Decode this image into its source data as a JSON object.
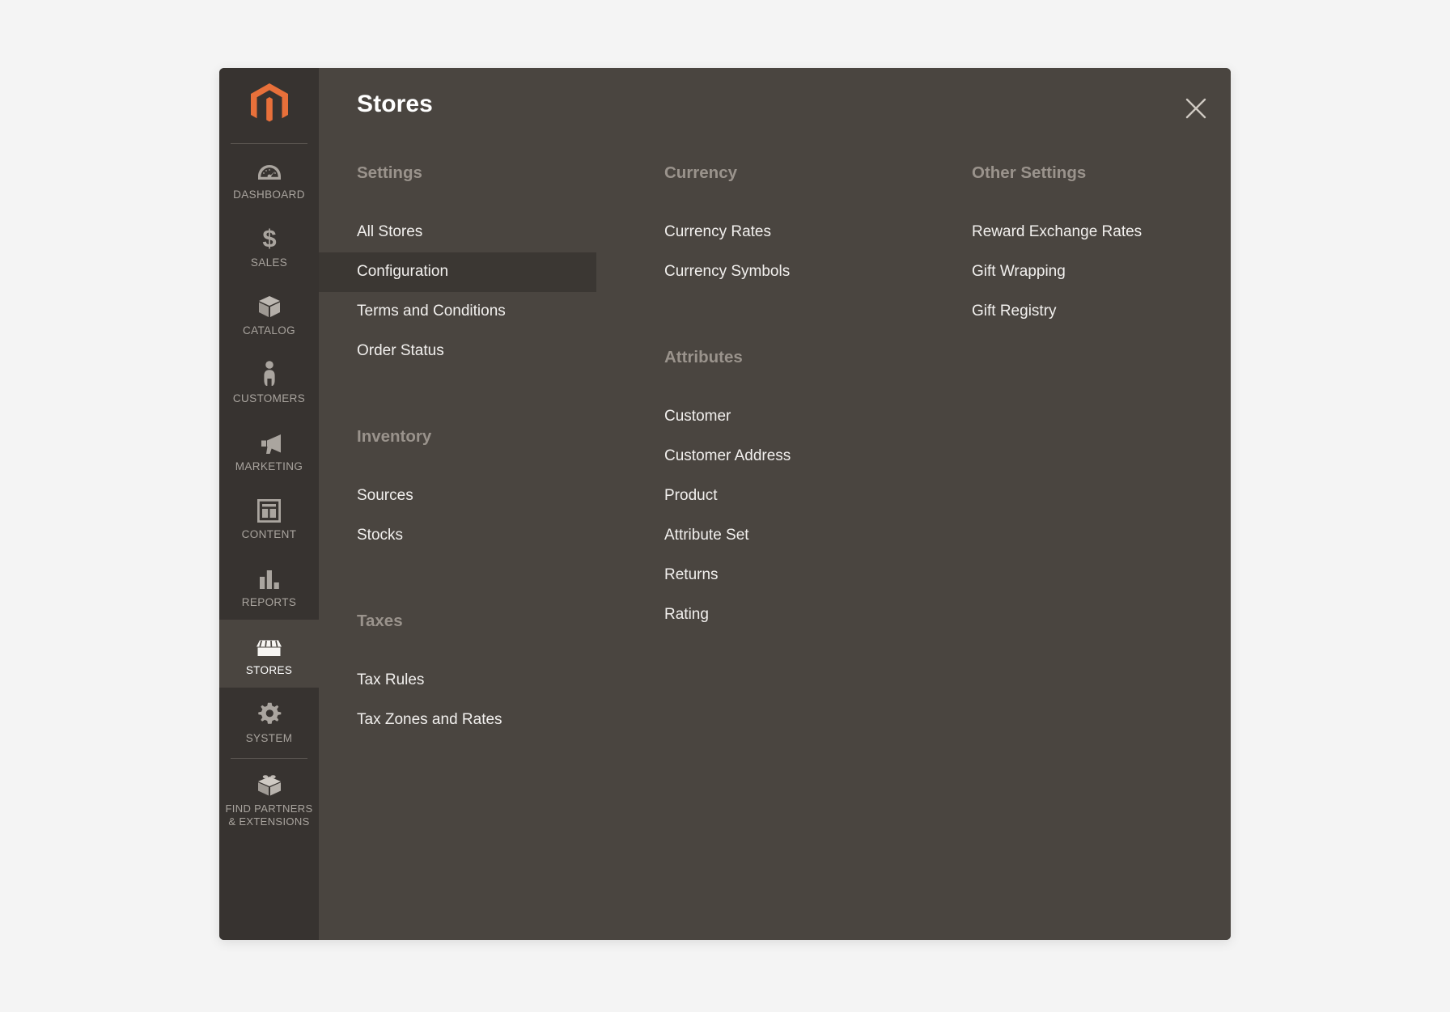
{
  "header": {
    "title": "Stores",
    "close_icon": "close-icon"
  },
  "sidebar": {
    "logo_icon": "magento-logo-icon",
    "logo_color": "#e8703a",
    "items": [
      {
        "label": "DASHBOARD",
        "icon": "gauge-icon",
        "active": false
      },
      {
        "label": "SALES",
        "icon": "dollar-icon",
        "active": false
      },
      {
        "label": "CATALOG",
        "icon": "box-icon",
        "active": false
      },
      {
        "label": "CUSTOMERS",
        "icon": "person-icon",
        "active": false
      },
      {
        "label": "MARKETING",
        "icon": "megaphone-icon",
        "active": false
      },
      {
        "label": "CONTENT",
        "icon": "layout-icon",
        "active": false
      },
      {
        "label": "REPORTS",
        "icon": "bar-chart-icon",
        "active": false
      },
      {
        "label": "STORES",
        "icon": "storefront-icon",
        "active": true
      },
      {
        "label": "SYSTEM",
        "icon": "gear-icon",
        "active": false
      },
      {
        "label": "FIND PARTNERS\n& EXTENSIONS",
        "label_line1": "FIND PARTNERS",
        "label_line2": "& EXTENSIONS",
        "icon": "lego-block-icon",
        "active": false
      }
    ]
  },
  "menu": {
    "columns": [
      {
        "groups": [
          {
            "title": "Settings",
            "links": [
              {
                "label": "All Stores",
                "active": false
              },
              {
                "label": "Configuration",
                "active": true
              },
              {
                "label": "Terms and Conditions",
                "active": false
              },
              {
                "label": "Order Status",
                "active": false
              }
            ]
          },
          {
            "title": "Inventory",
            "links": [
              {
                "label": "Sources",
                "active": false
              },
              {
                "label": "Stocks",
                "active": false
              }
            ]
          },
          {
            "title": "Taxes",
            "links": [
              {
                "label": "Tax Rules",
                "active": false
              },
              {
                "label": "Tax Zones and Rates",
                "active": false
              }
            ]
          }
        ]
      },
      {
        "groups": [
          {
            "title": "Currency",
            "links": [
              {
                "label": "Currency Rates",
                "active": false
              },
              {
                "label": "Currency Symbols",
                "active": false
              }
            ]
          },
          {
            "title": "Attributes",
            "links": [
              {
                "label": "Customer",
                "active": false
              },
              {
                "label": "Customer Address",
                "active": false
              },
              {
                "label": "Product",
                "active": false
              },
              {
                "label": "Attribute Set",
                "active": false
              },
              {
                "label": "Returns",
                "active": false
              },
              {
                "label": "Rating",
                "active": false
              }
            ]
          }
        ]
      },
      {
        "groups": [
          {
            "title": "Other Settings",
            "links": [
              {
                "label": "Reward Exchange Rates",
                "active": false
              },
              {
                "label": "Gift Wrapping",
                "active": false
              },
              {
                "label": "Gift Registry",
                "active": false
              }
            ]
          }
        ]
      }
    ]
  },
  "colors": {
    "sidebar_bg": "#373330",
    "content_bg": "#4a4540",
    "active_item_bg": "#3b3733",
    "accent_orange": "#e8703a",
    "page_bg": "#f4f4f4"
  }
}
